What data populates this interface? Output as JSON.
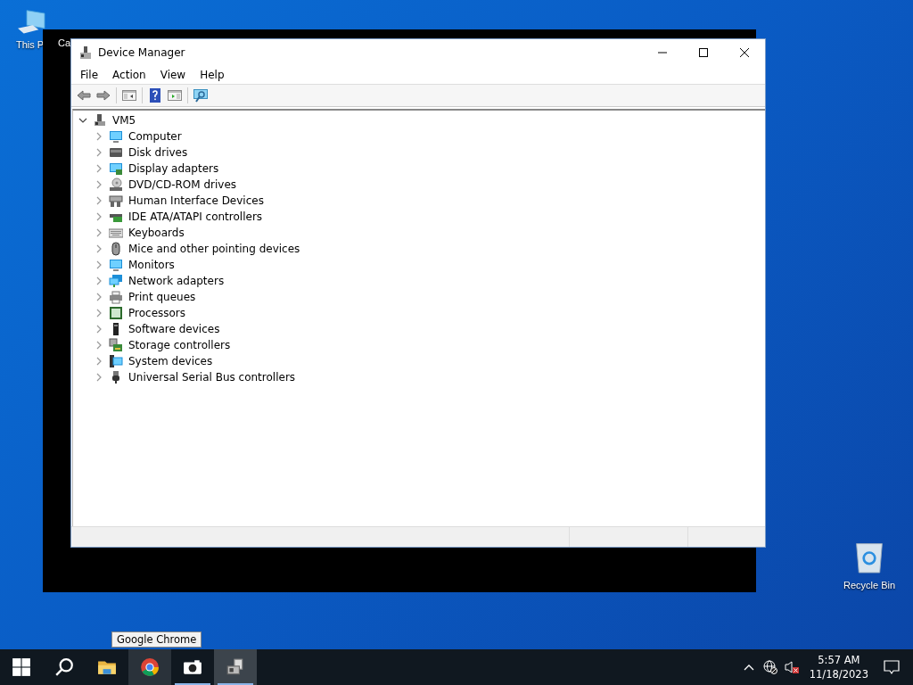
{
  "desktop_icons": [
    {
      "kind": "computer",
      "label": "This P"
    },
    {
      "kind": "recycle-bin",
      "label": "Recycle Bin"
    }
  ],
  "background_window": {
    "title": "Ca"
  },
  "window": {
    "title": "Device Manager"
  },
  "menu": [
    "File",
    "Action",
    "View",
    "Help"
  ],
  "toolbar": [
    {
      "kind": "back",
      "disabled": true
    },
    {
      "kind": "forward",
      "disabled": true
    },
    {
      "kind": "separator"
    },
    {
      "kind": "tree-toggle",
      "disabled": false
    },
    {
      "kind": "separator"
    },
    {
      "kind": "help",
      "disabled": false
    },
    {
      "kind": "properties",
      "disabled": false
    },
    {
      "kind": "separator"
    },
    {
      "kind": "scan",
      "disabled": false
    }
  ],
  "tree": [
    {
      "label": "VM5",
      "kind": "host",
      "expanded": true,
      "children": [
        {
          "label": "Computer",
          "kind": "monitor",
          "expanded": false
        },
        {
          "label": "Disk drives",
          "kind": "disk",
          "expanded": false
        },
        {
          "label": "Display adapters",
          "kind": "display",
          "expanded": false
        },
        {
          "label": "DVD/CD-ROM drives",
          "kind": "dvd",
          "expanded": false
        },
        {
          "label": "Human Interface Devices",
          "kind": "hid",
          "expanded": false
        },
        {
          "label": "IDE ATA/ATAPI controllers",
          "kind": "ide",
          "expanded": false
        },
        {
          "label": "Keyboards",
          "kind": "keyboard",
          "expanded": false
        },
        {
          "label": "Mice and other pointing devices",
          "kind": "mouse",
          "expanded": false
        },
        {
          "label": "Monitors",
          "kind": "monitor",
          "expanded": false
        },
        {
          "label": "Network adapters",
          "kind": "network",
          "expanded": false
        },
        {
          "label": "Print queues",
          "kind": "printer",
          "expanded": false
        },
        {
          "label": "Processors",
          "kind": "cpu",
          "expanded": false
        },
        {
          "label": "Software devices",
          "kind": "software",
          "expanded": false
        },
        {
          "label": "Storage controllers",
          "kind": "storage",
          "expanded": false
        },
        {
          "label": "System devices",
          "kind": "system",
          "expanded": false
        },
        {
          "label": "Universal Serial Bus controllers",
          "kind": "usb",
          "expanded": false
        }
      ]
    }
  ],
  "tooltip": "Google Chrome",
  "taskbar": [
    {
      "kind": "start",
      "running": false,
      "active": false,
      "hovered": false
    },
    {
      "kind": "search",
      "running": false,
      "active": false,
      "hovered": false
    },
    {
      "kind": "explorer",
      "running": false,
      "active": false,
      "hovered": false
    },
    {
      "kind": "chrome",
      "running": false,
      "active": false,
      "hovered": true
    },
    {
      "kind": "camera",
      "running": true,
      "active": false,
      "hovered": false
    },
    {
      "kind": "device-manager",
      "running": true,
      "active": true,
      "hovered": false
    }
  ],
  "tray": {
    "time": "5:57 AM",
    "date": "11/18/2023",
    "network_disconnected": true,
    "muted": true
  }
}
